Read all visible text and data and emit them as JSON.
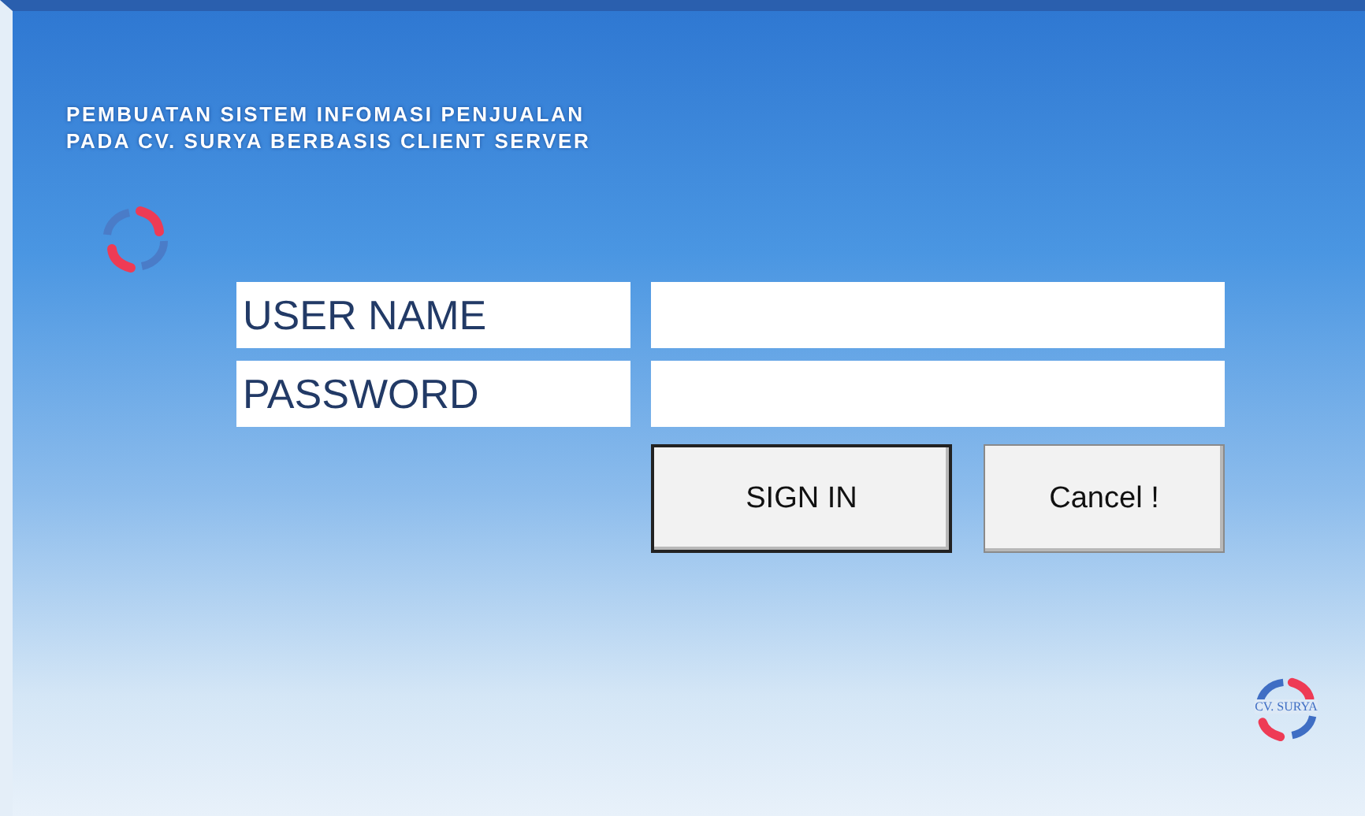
{
  "title_lines": [
    "PEMBUATAN SISTEM INFOMASI PENJUALAN",
    "PADA CV. SURYA BERBASIS CLIENT SERVER"
  ],
  "fields": [
    {
      "label": "USER NAME"
    },
    {
      "label": "PASSWORD"
    }
  ],
  "buttons": [
    {
      "label": "SIGN IN",
      "selected": true
    },
    {
      "label": "Cancel !",
      "selected": false
    }
  ],
  "company_logo": {
    "text": "CV. SURYA"
  }
}
